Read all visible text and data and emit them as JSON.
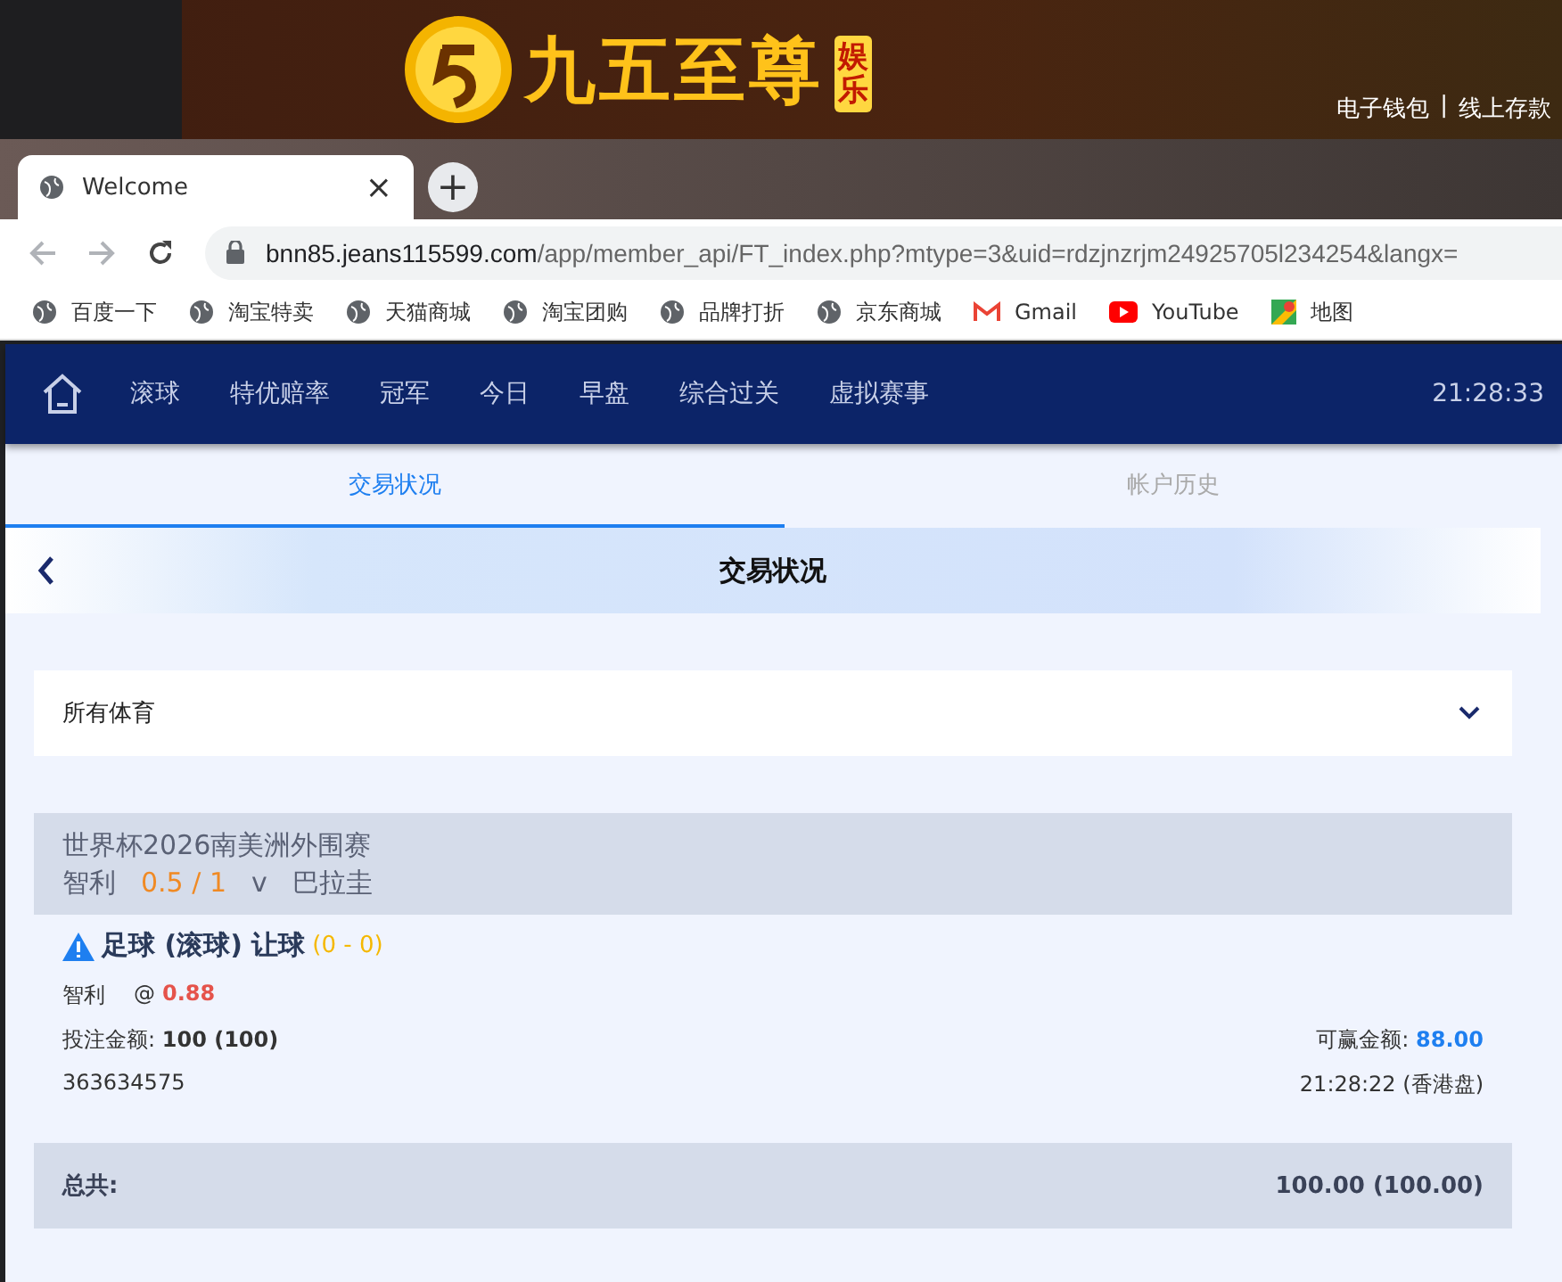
{
  "banner": {
    "logo_text": "九五至尊",
    "logo_badge": "娱乐",
    "links": [
      "电子钱包",
      "线上存款"
    ],
    "separator": "|"
  },
  "browser": {
    "tabs": [
      {
        "title": "Welcome",
        "selected": true
      }
    ],
    "new_tab": "+",
    "close": "×",
    "url_host": "bnn85.jeans115599.com",
    "url_path": "/app/member_api/FT_index.php?mtype=3&uid=rdzjnzrjm24925705l234254&langx=",
    "bookmarks": [
      {
        "label": "百度一下",
        "kind": "globe"
      },
      {
        "label": "淘宝特卖",
        "kind": "globe"
      },
      {
        "label": "天猫商城",
        "kind": "globe"
      },
      {
        "label": "淘宝团购",
        "kind": "globe"
      },
      {
        "label": "品牌打折",
        "kind": "globe"
      },
      {
        "label": "京东商城",
        "kind": "globe"
      },
      {
        "label": "Gmail",
        "kind": "gmail"
      },
      {
        "label": "YouTube",
        "kind": "youtube"
      },
      {
        "label": "地图",
        "kind": "maps"
      }
    ]
  },
  "nav": {
    "items": [
      "滚球",
      "特优赔率",
      "冠军",
      "今日",
      "早盘",
      "综合过关",
      "虚拟赛事"
    ],
    "time": "21:28:33"
  },
  "tabs": [
    {
      "label": "交易状况",
      "selected": true
    },
    {
      "label": "帐户历史",
      "selected": false
    }
  ],
  "header": {
    "title": "交易状况"
  },
  "filter": {
    "value": "所有体育"
  },
  "bet": {
    "league": "世界杯2026南美洲外围赛",
    "home": "智利",
    "handicap": "0.5 / 1",
    "vs": "v",
    "away": "巴拉圭",
    "market": "足球 (滚球) 让球",
    "score": "(0 - 0)",
    "selection": "智利",
    "at": "@",
    "odds": "0.88",
    "stake_label": "投注金额:",
    "stake": "100 (100)",
    "win_label": "可赢金额:",
    "win": "88.00",
    "ticket": "363634575",
    "time": "21:28:22 (香港盘)"
  },
  "total": {
    "label": "总共:",
    "value": "100.00 (100.00)"
  }
}
